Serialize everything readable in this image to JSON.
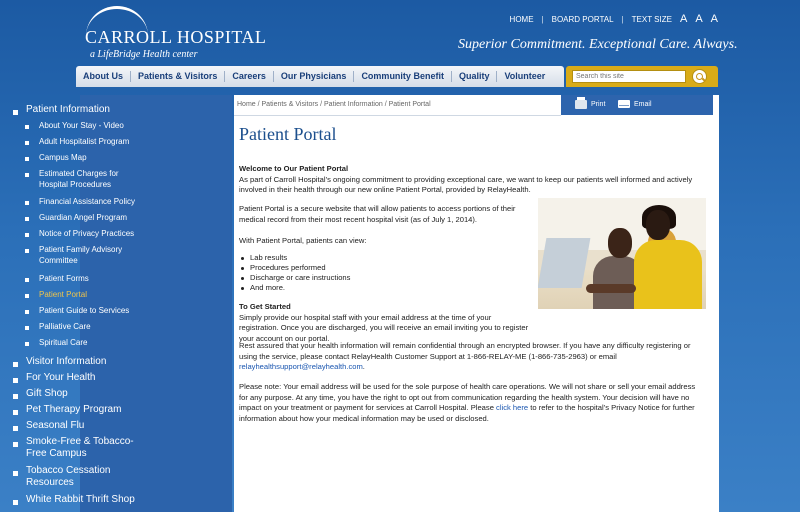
{
  "header": {
    "logo_name": "CARROLL HOSPITAL",
    "logo_sub": "a LifeBridge Health center",
    "tagline": "Superior Commitment. Exceptional Care. Always.",
    "utility": {
      "home": "HOME",
      "sep1": "|",
      "board": "BOARD PORTAL",
      "sep2": "|",
      "textsize": "TEXT SIZE",
      "a1": "A",
      "a2": "A",
      "a3": "A"
    }
  },
  "nav": {
    "items": [
      "About Us",
      "Patients & Visitors",
      "Careers",
      "Our Physicians",
      "Community Benefit",
      "Quality",
      "Volunteer"
    ]
  },
  "search": {
    "placeholder": "Search this site"
  },
  "sidebar": {
    "items": [
      {
        "label": "Patient Information",
        "level": 1
      },
      {
        "label": "About Your Stay - Video",
        "level": 2
      },
      {
        "label": "Adult Hospitalist Program",
        "level": 2
      },
      {
        "label": "Campus Map",
        "level": 2
      },
      {
        "label": "Estimated Charges for Hospital Procedures",
        "level": 2
      },
      {
        "label": "Financial Assistance Policy",
        "level": 2
      },
      {
        "label": "Guardian Angel Program",
        "level": 2
      },
      {
        "label": "Notice of Privacy Practices",
        "level": 2
      },
      {
        "label": "Patient Family Advisory Committee",
        "level": 2
      },
      {
        "label": "Patient Forms",
        "level": 2
      },
      {
        "label": "Patient Portal",
        "level": 2,
        "active": true
      },
      {
        "label": "Patient Guide to Services",
        "level": 2
      },
      {
        "label": "Palliative Care",
        "level": 2
      },
      {
        "label": "Spiritual Care",
        "level": 2
      },
      {
        "label": "Visitor Information",
        "level": 1
      },
      {
        "label": "For Your Health",
        "level": 1
      },
      {
        "label": "Gift Shop",
        "level": 1
      },
      {
        "label": "Pet Therapy Program",
        "level": 1
      },
      {
        "label": "Seasonal Flu",
        "level": 1
      },
      {
        "label": "Smoke-Free & Tobacco-Free Campus",
        "level": 1
      },
      {
        "label": "Tobacco Cessation Resources",
        "level": 1
      },
      {
        "label": "White Rabbit Thrift Shop",
        "level": 1
      }
    ],
    "active_color": "#f0c54a"
  },
  "breadcrumb": "Home / Patients & Visitors / Patient Information / Patient Portal",
  "tools": {
    "print": "Print",
    "email": "Email"
  },
  "main": {
    "title": "Patient Portal",
    "welcome_heading": "Welcome to Our Patient Portal",
    "welcome_text": "As part of Carroll Hospital’s ongoing commitment to providing exceptional care, we want to keep our patients well informed and actively involved in their health through our new online Patient Portal, provided by RelayHealth.",
    "portal_text": "Patient Portal is a secure website that will allow patients to access portions of their medical record from their most recent hospital visit (as of July 1, 2014).",
    "view_text": "With Patient Portal, patients can view:",
    "list": [
      "Lab results",
      "Procedures performed",
      "Discharge or care instructions",
      "And more."
    ],
    "started_heading": "To Get Started",
    "started_text": "Simply provide our hospital staff with your email address at the time of your registration. Once you are discharged, you will receive an email inviting you to register your account on our portal.",
    "rest_text": "Rest assured that your health information will remain confidential through an encrypted browser. If you have any difficulty registering or using the service, please contact RelayHealth Customer Support at 1-866-RELAY-ME (1-866-735-2963) or email",
    "support_email": "relayhealthsupport@relayhealth.com",
    "support_end": ".",
    "note_text": "Please note: Your email address will be used for the sole purpose of health care operations. We will not share or sell your email address for any purpose. At any time, you have the right to opt out from communication regarding the health system. Your decision will have no impact on your treatment or payment for services at Carroll Hospital. Please",
    "click_here": "click here",
    "note_end": "to refer to the hospital’s Privacy Notice for further information about how your medical information may be used or disclosed."
  }
}
